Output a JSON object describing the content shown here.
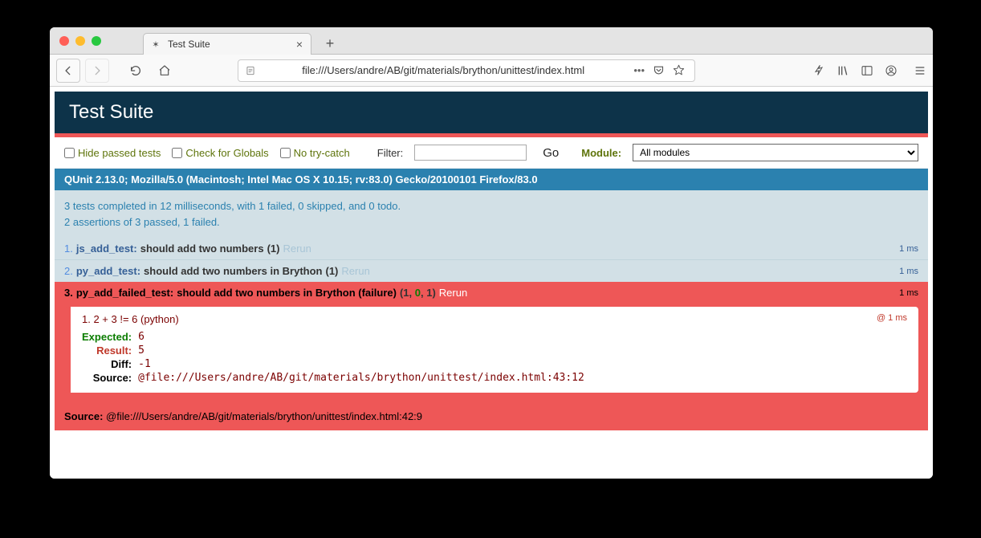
{
  "browser": {
    "tab_title": "Test Suite",
    "url": "file:///Users/andre/AB/git/materials/brython/unittest/index.html",
    "new_tab_label": "+"
  },
  "toolbar": {
    "hide_passed": "Hide passed tests",
    "check_globals": "Check for Globals",
    "no_trycatch": "No try-catch",
    "filter_label": "Filter:",
    "filter_value": "",
    "go_label": "Go",
    "module_label": "Module:",
    "module_selected": "All modules"
  },
  "qunit": {
    "header_title": "Test Suite",
    "user_agent": "QUnit 2.13.0; Mozilla/5.0 (Macintosh; Intel Mac OS X 10.15; rv:83.0) Gecko/20100101 Firefox/83.0",
    "summary_line1": "3 tests completed in 12 milliseconds, with 1 failed, 0 skipped, and 0 todo.",
    "summary_line2": "2 assertions of 3 passed, 1 failed.",
    "rerun_label": "Rerun"
  },
  "tests": [
    {
      "index": "1.",
      "module": "js_add_test:",
      "desc": "should add two numbers",
      "counts": "(1)",
      "time": "1 ms",
      "status": "pass"
    },
    {
      "index": "2.",
      "module": "py_add_test:",
      "desc": "should add two numbers in Brython",
      "counts": "(1)",
      "time": "1 ms",
      "status": "pass"
    },
    {
      "index": "3.",
      "module": "py_add_failed_test:",
      "desc": "should add two numbers in Brython (failure)",
      "counts_prefix": "(1, ",
      "counts_pass": "0",
      "counts_suffix": ", 1)",
      "time": "1 ms",
      "status": "fail"
    }
  ],
  "failure": {
    "assert_title": "1. 2 + 3 != 6 (python)",
    "assert_time": "@ 1 ms",
    "expected_label": "Expected:",
    "expected_value": "6",
    "result_label": "Result:",
    "result_value": "5",
    "diff_label": "Diff:",
    "diff_value": "-1",
    "source_label": "Source:",
    "source_value": "@file:///Users/andre/AB/git/materials/brython/unittest/index.html:43:12",
    "outer_source_label": "Source:",
    "outer_source_value": "@file:///Users/andre/AB/git/materials/brython/unittest/index.html:42:9"
  }
}
